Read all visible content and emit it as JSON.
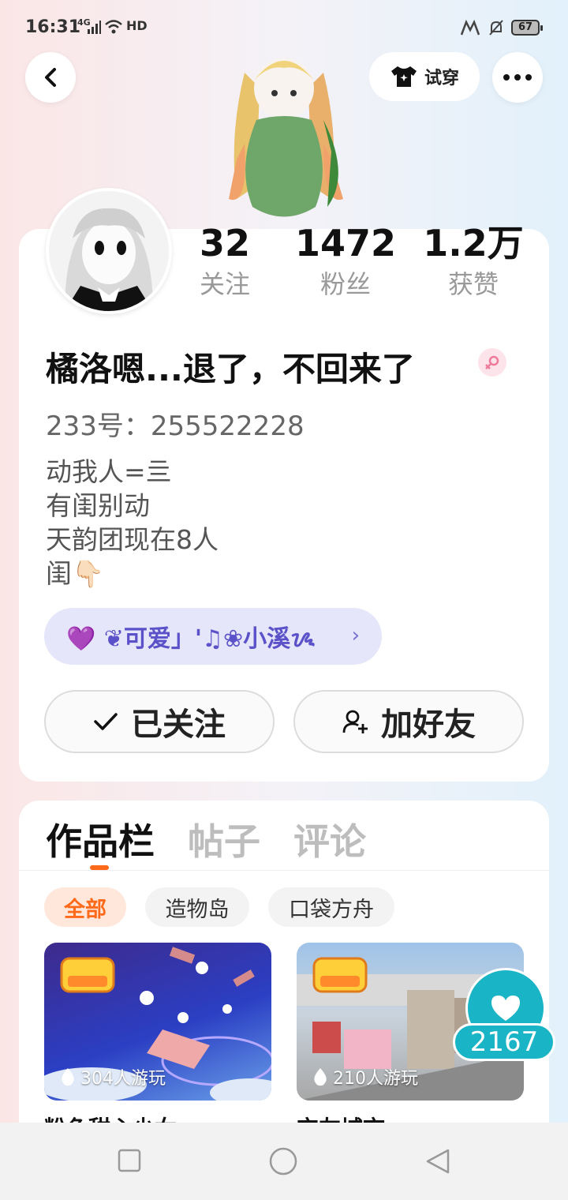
{
  "status_bar": {
    "time": "16:31",
    "network": "4G",
    "hd": "HD",
    "battery": "67"
  },
  "header": {
    "try_on_label": "试穿"
  },
  "stats": [
    {
      "value": "32",
      "label": "关注"
    },
    {
      "value": "1472",
      "label": "粉丝"
    },
    {
      "value": "1.2万",
      "label": "获赞"
    }
  ],
  "profile": {
    "name": "橘洛嗯...退了，不回来了",
    "uid": "233号：255522228",
    "bio": [
      "动我人=亖",
      "有闺别动",
      "天韵团现在8人",
      "闺👇🏻"
    ],
    "guild": "💜 ❦可爱」'♫❀小溪ᝰ"
  },
  "actions": {
    "follow_label": "已关注",
    "add_friend_label": "加好友"
  },
  "tabs": [
    {
      "label": "作品栏",
      "active": true
    },
    {
      "label": "帖子",
      "active": false
    },
    {
      "label": "评论",
      "active": false
    }
  ],
  "filters": [
    {
      "label": "全部",
      "active": true
    },
    {
      "label": "造物岛",
      "active": false
    },
    {
      "label": "口袋方舟",
      "active": false
    }
  ],
  "games": [
    {
      "plays": "304人游玩",
      "title": "粉色甜心少女",
      "badge": "233造物岛"
    },
    {
      "plays": "210人游玩",
      "title": "交友城市",
      "badge": "233造物岛"
    }
  ],
  "like_fab": {
    "count": "2167"
  },
  "colors": {
    "accent": "#ff6a1a",
    "teal": "#19b4c6",
    "guild_text": "#5b52c9"
  }
}
